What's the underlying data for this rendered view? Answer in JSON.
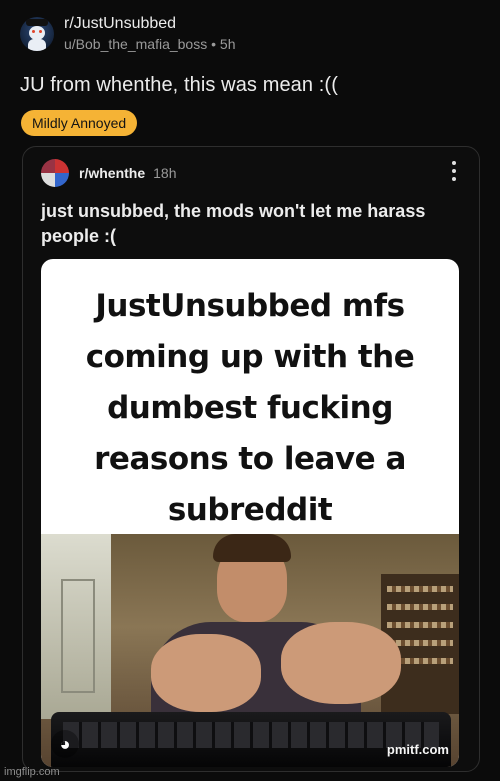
{
  "post": {
    "subreddit": "r/JustUnsubbed",
    "author": "u/Bob_the_mafia_boss",
    "separator": " • ",
    "age": "5h",
    "title": "JU from whenthe, this was mean :((",
    "flair": "Mildly Annoyed"
  },
  "crosspost": {
    "subreddit": "r/whenthe",
    "age": "18h",
    "title": "just unsubbed, the mods won't let me harass people :(",
    "image": {
      "caption_lines": [
        "JustUnsubbed mfs",
        "coming up with the",
        "dumbest fucking",
        "reasons to leave a",
        "subreddit"
      ],
      "watermark": "pmitf.com"
    }
  },
  "footer": {
    "imgflip": "imgflip.com"
  },
  "colors": {
    "flair_bg": "#f5b335",
    "background": "#0b0b0b"
  }
}
